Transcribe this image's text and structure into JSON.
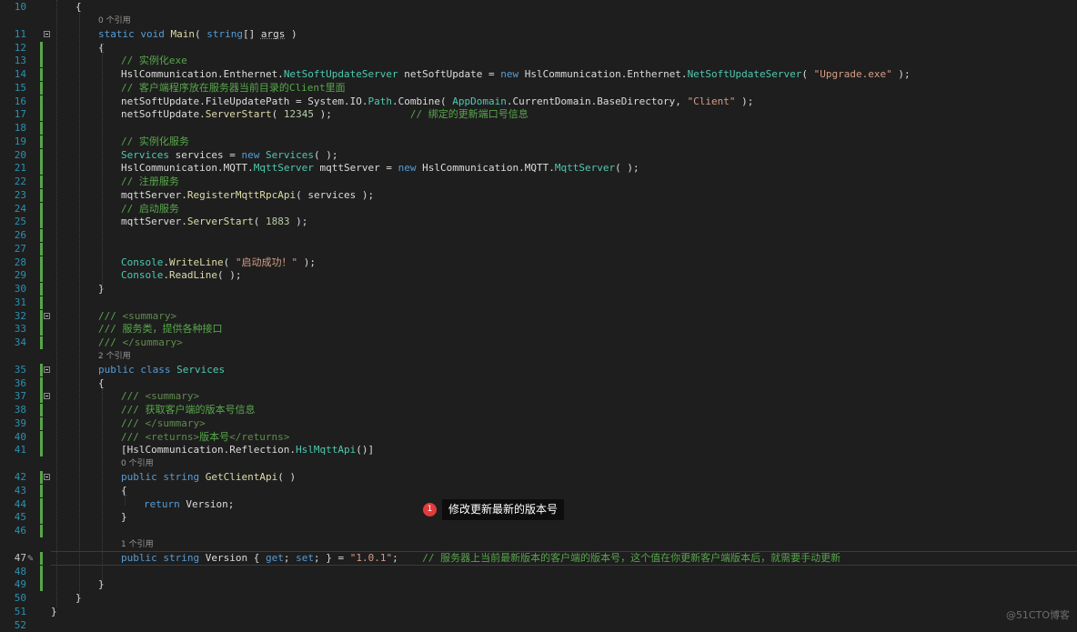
{
  "colors": {
    "background": "#1e1e1e",
    "keyword": "#569cd6",
    "type": "#4ec9b0",
    "method": "#dcdcaa",
    "string": "#d69d85",
    "number": "#b5cea8",
    "comment": "#57a64a",
    "doc_tag": "#608b4e",
    "plain": "#dcdcdc",
    "line_number": "#2b91af",
    "codelens": "#999999"
  },
  "icons": [
    "collapse-icon",
    "quick-action-icon",
    "annotation-badge-icon"
  ],
  "lines": [
    {
      "n": "10",
      "indent": 0,
      "tokens": [
        [
          "{",
          "p"
        ]
      ]
    },
    {
      "n": "11",
      "indent": 1,
      "codelens": "0 个引用",
      "fold": true,
      "tokens": [
        [
          "static",
          "k"
        ],
        [
          " ",
          "p"
        ],
        [
          "void",
          "k"
        ],
        [
          " ",
          "p"
        ],
        [
          "Main",
          "m"
        ],
        [
          "( ",
          "p"
        ],
        [
          "string",
          "k"
        ],
        [
          "[] ",
          "p"
        ],
        [
          "args",
          "v"
        ],
        [
          " )",
          "p"
        ]
      ]
    },
    {
      "n": "12",
      "indent": 1,
      "mod": true,
      "tokens": [
        [
          "{",
          "p"
        ]
      ]
    },
    {
      "n": "13",
      "indent": 2,
      "mod": true,
      "tokens": [
        [
          "// 实例化exe",
          "c"
        ]
      ]
    },
    {
      "n": "14",
      "indent": 2,
      "mod": true,
      "tokens": [
        [
          "HslCommunication.Enthernet.",
          "p"
        ],
        [
          "NetSoftUpdateServer",
          "t"
        ],
        [
          " netSoftUpdate = ",
          "p"
        ],
        [
          "new",
          "k"
        ],
        [
          " HslCommunication.Enthernet.",
          "p"
        ],
        [
          "NetSoftUpdateServer",
          "t"
        ],
        [
          "( ",
          "p"
        ],
        [
          "\"Upgrade.exe\"",
          "s"
        ],
        [
          " );",
          "p"
        ]
      ]
    },
    {
      "n": "15",
      "indent": 2,
      "mod": true,
      "tokens": [
        [
          "// 客户端程序放在服务器当前目录的Client里面",
          "c"
        ]
      ]
    },
    {
      "n": "16",
      "indent": 2,
      "mod": true,
      "tokens": [
        [
          "netSoftUpdate.FileUpdatePath = System.IO.",
          "p"
        ],
        [
          "Path",
          "t"
        ],
        [
          ".Combine( ",
          "p"
        ],
        [
          "AppDomain",
          "t"
        ],
        [
          ".CurrentDomain.BaseDirectory, ",
          "p"
        ],
        [
          "\"Client\"",
          "s"
        ],
        [
          " );",
          "p"
        ]
      ]
    },
    {
      "n": "17",
      "indent": 2,
      "mod": true,
      "tokens": [
        [
          "netSoftUpdate.",
          "p"
        ],
        [
          "ServerStart",
          "m"
        ],
        [
          "( ",
          "p"
        ],
        [
          "12345",
          "n"
        ],
        [
          " );             ",
          "p"
        ],
        [
          "// 绑定的更新端口号信息",
          "c"
        ]
      ]
    },
    {
      "n": "18",
      "indent": 2,
      "mod": true,
      "tokens": []
    },
    {
      "n": "19",
      "indent": 2,
      "mod": true,
      "tokens": [
        [
          "// 实例化服务",
          "c"
        ]
      ]
    },
    {
      "n": "20",
      "indent": 2,
      "mod": true,
      "tokens": [
        [
          "Services",
          "t"
        ],
        [
          " services = ",
          "p"
        ],
        [
          "new",
          "k"
        ],
        [
          " ",
          "p"
        ],
        [
          "Services",
          "t"
        ],
        [
          "( );",
          "p"
        ]
      ]
    },
    {
      "n": "21",
      "indent": 2,
      "mod": true,
      "tokens": [
        [
          "HslCommunication.MQTT.",
          "p"
        ],
        [
          "MqttServer",
          "t"
        ],
        [
          " mqttServer = ",
          "p"
        ],
        [
          "new",
          "k"
        ],
        [
          " HslCommunication.MQTT.",
          "p"
        ],
        [
          "MqttServer",
          "t"
        ],
        [
          "( );",
          "p"
        ]
      ]
    },
    {
      "n": "22",
      "indent": 2,
      "mod": true,
      "tokens": [
        [
          "// 注册服务",
          "c"
        ]
      ]
    },
    {
      "n": "23",
      "indent": 2,
      "mod": true,
      "tokens": [
        [
          "mqttServer.",
          "p"
        ],
        [
          "RegisterMqttRpcApi",
          "m"
        ],
        [
          "( services );",
          "p"
        ]
      ]
    },
    {
      "n": "24",
      "indent": 2,
      "mod": true,
      "tokens": [
        [
          "// 启动服务",
          "c"
        ]
      ]
    },
    {
      "n": "25",
      "indent": 2,
      "mod": true,
      "tokens": [
        [
          "mqttServer.",
          "p"
        ],
        [
          "ServerStart",
          "m"
        ],
        [
          "( ",
          "p"
        ],
        [
          "1883",
          "n"
        ],
        [
          " );",
          "p"
        ]
      ]
    },
    {
      "n": "26",
      "indent": 2,
      "mod": true,
      "tokens": []
    },
    {
      "n": "27",
      "indent": 2,
      "mod": true,
      "tokens": []
    },
    {
      "n": "28",
      "indent": 2,
      "mod": true,
      "tokens": [
        [
          "Console",
          "t"
        ],
        [
          ".",
          "p"
        ],
        [
          "WriteLine",
          "m"
        ],
        [
          "( ",
          "p"
        ],
        [
          "\"启动成功！\"",
          "s"
        ],
        [
          " );",
          "p"
        ]
      ]
    },
    {
      "n": "29",
      "indent": 2,
      "mod": true,
      "tokens": [
        [
          "Console",
          "t"
        ],
        [
          ".",
          "p"
        ],
        [
          "ReadLine",
          "m"
        ],
        [
          "( );",
          "p"
        ]
      ]
    },
    {
      "n": "30",
      "indent": 1,
      "mod": true,
      "tokens": [
        [
          "}",
          "p"
        ]
      ]
    },
    {
      "n": "31",
      "indent": 1,
      "mod": true,
      "tokens": []
    },
    {
      "n": "32",
      "indent": 1,
      "fold": true,
      "mod": true,
      "tokens": [
        [
          "/// ",
          "c"
        ],
        [
          "<summary>",
          "d"
        ]
      ]
    },
    {
      "n": "33",
      "indent": 1,
      "mod": true,
      "tokens": [
        [
          "/// 服务类，提供各种接口",
          "c"
        ]
      ]
    },
    {
      "n": "34",
      "indent": 1,
      "mod": true,
      "tokens": [
        [
          "/// ",
          "c"
        ],
        [
          "</summary>",
          "d"
        ]
      ]
    },
    {
      "n": "35",
      "indent": 1,
      "codelens": "2 个引用",
      "fold": true,
      "mod": true,
      "tokens": [
        [
          "public",
          "k"
        ],
        [
          " ",
          "p"
        ],
        [
          "class",
          "k"
        ],
        [
          " ",
          "p"
        ],
        [
          "Services",
          "t"
        ]
      ]
    },
    {
      "n": "36",
      "indent": 1,
      "mod": true,
      "tokens": [
        [
          "{",
          "p"
        ]
      ]
    },
    {
      "n": "37",
      "indent": 2,
      "fold": true,
      "mod": true,
      "tokens": [
        [
          "/// ",
          "c"
        ],
        [
          "<summary>",
          "d"
        ]
      ]
    },
    {
      "n": "38",
      "indent": 2,
      "mod": true,
      "tokens": [
        [
          "/// 获取客户端的版本号信息",
          "c"
        ]
      ]
    },
    {
      "n": "39",
      "indent": 2,
      "mod": true,
      "tokens": [
        [
          "/// ",
          "c"
        ],
        [
          "</summary>",
          "d"
        ]
      ]
    },
    {
      "n": "40",
      "indent": 2,
      "mod": true,
      "tokens": [
        [
          "/// ",
          "c"
        ],
        [
          "<returns>",
          "d"
        ],
        [
          "版本号",
          "c"
        ],
        [
          "</returns>",
          "d"
        ]
      ]
    },
    {
      "n": "41",
      "indent": 2,
      "mod": true,
      "tokens": [
        [
          "[HslCommunication.Reflection.",
          "p"
        ],
        [
          "HslMqttApi",
          "t"
        ],
        [
          "()]",
          "p"
        ]
      ]
    },
    {
      "n": "42",
      "indent": 2,
      "codelens": "0 个引用",
      "fold": true,
      "mod": true,
      "tokens": [
        [
          "public",
          "k"
        ],
        [
          " ",
          "p"
        ],
        [
          "string",
          "k"
        ],
        [
          " ",
          "p"
        ],
        [
          "GetClientApi",
          "m"
        ],
        [
          "( )",
          "p"
        ]
      ]
    },
    {
      "n": "43",
      "indent": 2,
      "mod": true,
      "tokens": [
        [
          "{",
          "p"
        ]
      ]
    },
    {
      "n": "44",
      "indent": 3,
      "mod": true,
      "tokens": [
        [
          "return",
          "k"
        ],
        [
          " Version;",
          "p"
        ]
      ]
    },
    {
      "n": "45",
      "indent": 2,
      "mod": true,
      "tokens": [
        [
          "}",
          "p"
        ]
      ]
    },
    {
      "n": "46",
      "indent": 2,
      "mod": true,
      "tokens": []
    },
    {
      "n": "47",
      "indent": 2,
      "codelens": "1 个引用",
      "current": true,
      "quick": true,
      "mod": true,
      "tokens": [
        [
          "public",
          "k"
        ],
        [
          " ",
          "p"
        ],
        [
          "string",
          "k"
        ],
        [
          " Version { ",
          "p"
        ],
        [
          "get",
          "k"
        ],
        [
          "; ",
          "p"
        ],
        [
          "set",
          "k"
        ],
        [
          "; } = ",
          "p"
        ],
        [
          "\"1.0.1\"",
          "s"
        ],
        [
          ";    ",
          "p"
        ],
        [
          "// 服务器上当前最新版本的客户端的版本号，这个值在你更新客户端版本后，就需要手动更新",
          "c"
        ]
      ]
    },
    {
      "n": "48",
      "indent": 2,
      "mod": true,
      "tokens": []
    },
    {
      "n": "49",
      "indent": 1,
      "mod": true,
      "tokens": [
        [
          "}",
          "p"
        ]
      ]
    },
    {
      "n": "50",
      "indent": 0,
      "tokens": [
        [
          "}",
          "p"
        ]
      ]
    },
    {
      "n": "51",
      "indent": -1,
      "tokens": [
        [
          "}",
          "p"
        ]
      ]
    },
    {
      "n": "52",
      "indent": -1,
      "tokens": []
    }
  ],
  "annotation": {
    "badge": "1",
    "text": "修改更新最新的版本号"
  },
  "watermark": "@51CTO博客"
}
